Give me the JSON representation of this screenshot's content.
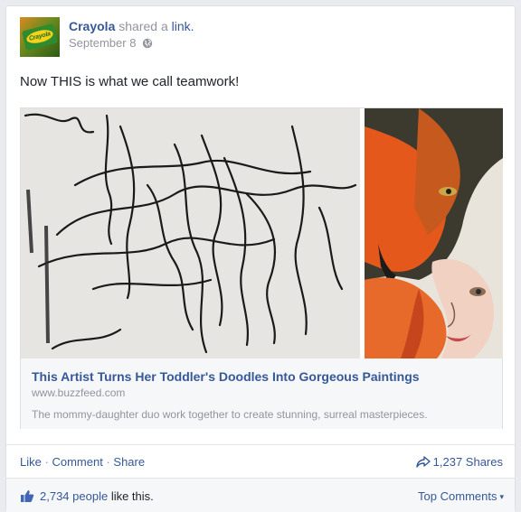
{
  "post": {
    "page_name": "Crayola",
    "action_text": "shared a",
    "action_link": "link.",
    "date": "September 8",
    "privacy_icon": "globe-icon",
    "avatar_text": "Crayola",
    "message": "Now THIS is what we call teamwork!"
  },
  "attachment": {
    "title": "This Artist Turns Her Toddler's Doodles Into Gorgeous Paintings",
    "domain": "www.buzzfeed.com",
    "description": "The mommy-daughter duo work together to create stunning, surreal masterpieces."
  },
  "actions": {
    "like": "Like",
    "sep": "·",
    "comment": "Comment",
    "share": "Share",
    "shares_count": "1,237 Shares"
  },
  "likes": {
    "count": "2,734 people",
    "suffix": "like this.",
    "top_comments": "Top Comments",
    "caret": "▾"
  },
  "colors": {
    "link_blue": "#365899",
    "meta_gray": "#90949c",
    "panel_bg": "#f6f7f9"
  }
}
